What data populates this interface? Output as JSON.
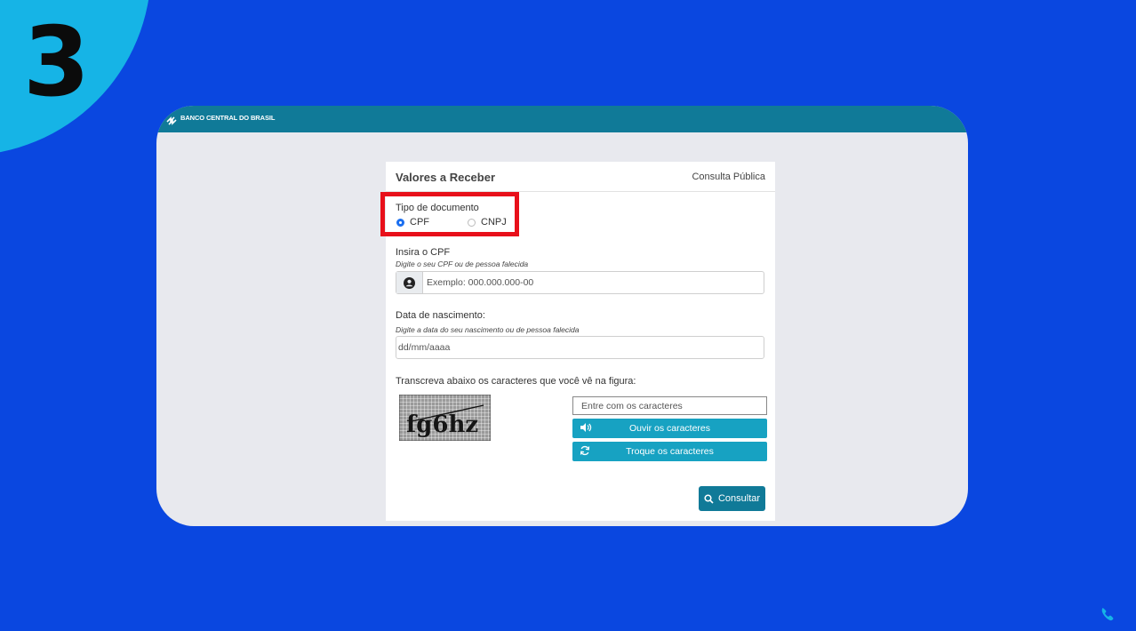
{
  "step": {
    "number": "3"
  },
  "header": {
    "bank_name": "BANCO CENTRAL DO BRASIL"
  },
  "panel": {
    "title": "Valores a Receber",
    "subtitle": "Consulta Pública"
  },
  "document_type": {
    "label": "Tipo de documento",
    "options": [
      {
        "label": "CPF",
        "selected": true
      },
      {
        "label": "CNPJ",
        "selected": false
      }
    ]
  },
  "cpf": {
    "label": "Insira o CPF",
    "hint": "Digite o seu CPF ou de pessoa falecida",
    "placeholder": "Exemplo: 000.000.000-00"
  },
  "birth": {
    "label": "Data de nascimento:",
    "hint": "Digite a data do seu nascimento ou de pessoa falecida",
    "placeholder": "dd/mm/aaaa"
  },
  "captcha": {
    "instruction": "Transcreva abaixo os caracteres que você vê na figura:",
    "image_text": "fg6hz",
    "input_placeholder": "Entre com os caracteres",
    "listen_label": "Ouvir os caracteres",
    "refresh_label": "Troque os caracteres"
  },
  "submit": {
    "label": "Consultar"
  },
  "colors": {
    "background": "#0a47e0",
    "accent": "#16b4e6",
    "header": "#107a98",
    "highlight": "#e8101a",
    "button": "#17a2c2",
    "radio_selected": "#1b6ff0"
  }
}
